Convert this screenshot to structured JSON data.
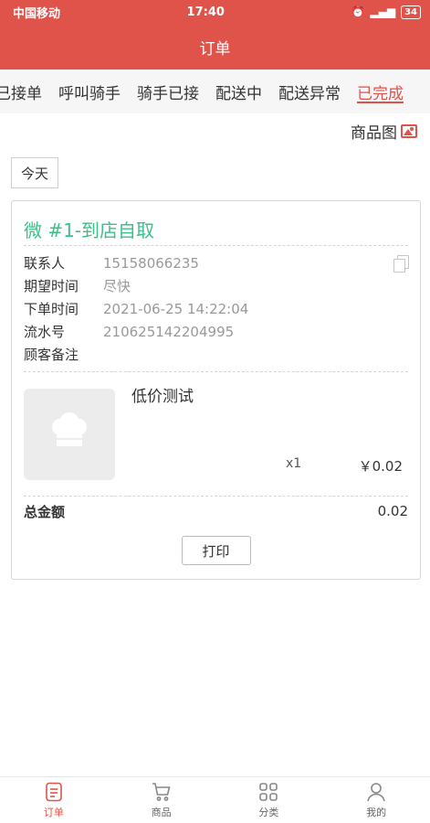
{
  "status_bar": {
    "carrier": "中国移动",
    "time": "17:40",
    "battery": "34"
  },
  "header": {
    "title": "订单"
  },
  "tabs": [
    {
      "label": "已接单"
    },
    {
      "label": "呼叫骑手"
    },
    {
      "label": "骑手已接"
    },
    {
      "label": "配送中"
    },
    {
      "label": "配送异常"
    },
    {
      "label": "已完成"
    }
  ],
  "active_tab": "已完成",
  "image_toggle": {
    "label": "商品图"
  },
  "date_filter": {
    "label": "今天"
  },
  "order": {
    "title": "微 #1-到店自取",
    "contact_label": "联系人",
    "contact_value": "15158066235",
    "expected_time_label": "期望时间",
    "expected_time_value": "尽快",
    "order_time_label": "下单时间",
    "order_time_value": "2021-06-25 14:22:04",
    "serial_label": "流水号",
    "serial_value": "210625142204995",
    "note_label": "顾客备注",
    "note_value": "",
    "item": {
      "name": "低价测试",
      "quantity": "x1",
      "price": "￥0.02"
    },
    "total_label": "总金额",
    "total_value": "0.02",
    "print_label": "打印"
  },
  "bottom_nav": [
    {
      "label": "订单",
      "icon": "order-icon",
      "active": true
    },
    {
      "label": "商品",
      "icon": "cart-icon",
      "active": false
    },
    {
      "label": "分类",
      "icon": "grid-icon",
      "active": false
    },
    {
      "label": "我的",
      "icon": "user-icon",
      "active": false
    }
  ],
  "colors": {
    "primary": "#e0534a",
    "order_title": "#3cbf88",
    "copy_icon": "#e8c07a"
  }
}
